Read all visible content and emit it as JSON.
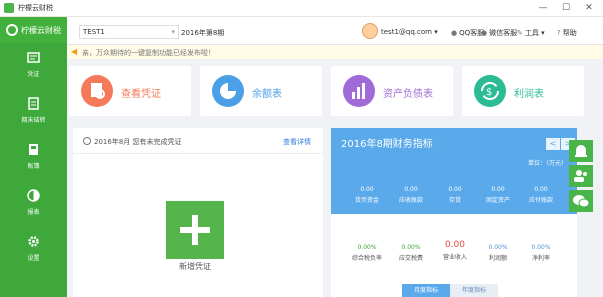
{
  "window": {
    "title": "柠檬云财税",
    "minimize": "—",
    "maximize": "☐",
    "close": "✕"
  },
  "brand": {
    "name": "柠檬云财税"
  },
  "sidebar": {
    "items": [
      {
        "label": "凭证",
        "icon": "voucher-icon"
      },
      {
        "label": "期末结转",
        "icon": "clipboard-icon"
      },
      {
        "label": "账簿",
        "icon": "ledger-icon"
      },
      {
        "label": "报表",
        "icon": "pie-chart-icon"
      },
      {
        "label": "设置",
        "icon": "gear-icon"
      }
    ]
  },
  "header": {
    "company": "TEST1",
    "period": "2016年第8期",
    "user_email": "test1@qq.com",
    "links": {
      "qq": "QQ客服",
      "wechat": "微信客服",
      "tools": "工具",
      "help": "帮助"
    }
  },
  "notice": "亲，万众期待的一键复制功能已经发布啦！",
  "cards": [
    {
      "label": "查看凭证",
      "color": "#f47a5a"
    },
    {
      "label": "余额表",
      "color": "#4a9fe6"
    },
    {
      "label": "资产负债表",
      "color": "#a06bd6"
    },
    {
      "label": "利润表",
      "color": "#2bbc96"
    }
  ],
  "left_panel": {
    "title": "2016年8月 您有未完成凭证",
    "link": "查看详情",
    "add_label": "新增凭证"
  },
  "right_panel": {
    "title": "2016年8期财务指标",
    "prev": "<",
    "next": ">",
    "unit": "单位：（万元）",
    "top_metrics": [
      {
        "value": "0.00",
        "label": "货币资金"
      },
      {
        "value": "0.00",
        "label": "应收账款"
      },
      {
        "value": "0.00",
        "label": "存货"
      },
      {
        "value": "0.00",
        "label": "固定资产"
      },
      {
        "value": "0.00",
        "label": "应付账款"
      }
    ],
    "bottom_metrics": [
      {
        "value": "0.00%",
        "label": "综合税负率"
      },
      {
        "value": "0.00%",
        "label": "应交税费"
      },
      {
        "value": "0.00",
        "label": "营业收入"
      },
      {
        "value": "0.00%",
        "label": "利润额"
      },
      {
        "value": "0.00%",
        "label": "净利率"
      }
    ],
    "tabs": [
      {
        "label": "月度指标"
      },
      {
        "label": "年度指标"
      }
    ]
  },
  "float_bar": [
    {
      "icon": "bell-icon"
    },
    {
      "icon": "contacts-icon"
    },
    {
      "icon": "wechat-icon"
    }
  ],
  "colors": {
    "green": "#3ea83a",
    "blue": "#5aa9ea",
    "red": "#e74c3c"
  }
}
